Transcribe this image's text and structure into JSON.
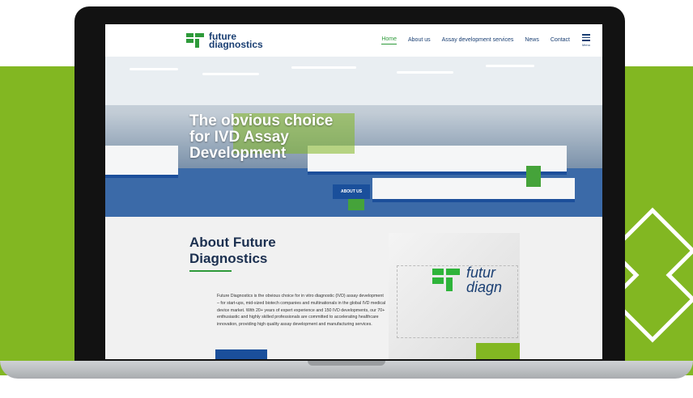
{
  "site": {
    "logo_line1": "future",
    "logo_line2": "diagnostics",
    "nav": [
      {
        "label": "Home",
        "active": true
      },
      {
        "label": "About us",
        "active": false
      },
      {
        "label": "Assay development services",
        "active": false
      },
      {
        "label": "News",
        "active": false
      },
      {
        "label": "Contact",
        "active": false
      }
    ],
    "menu_label": "Menu"
  },
  "hero": {
    "title": "The obvious choice for IVD Assay Development",
    "button_label": "ABOUT US"
  },
  "about": {
    "title": "About Future Diagnostics",
    "body": "Future Diagnostics is the obvious choice for in vitro diagnostic (IVD) assay development – for start-ups, mid-sized biotech companies and multinationals in the global IVD medical device market. With 20+ years of expert experience and 150 IVD developments, our 70+ enthusiastic and highly skilled professionals are committed to accelerating healthcare innovation, providing high quality assay development and manufacturing services.",
    "image_brand_line1": "futur",
    "image_brand_line2": "diagn"
  },
  "colors": {
    "brand_green": "#82b722",
    "brand_blue": "#1a3f73",
    "button_blue": "#1a4f9b"
  }
}
